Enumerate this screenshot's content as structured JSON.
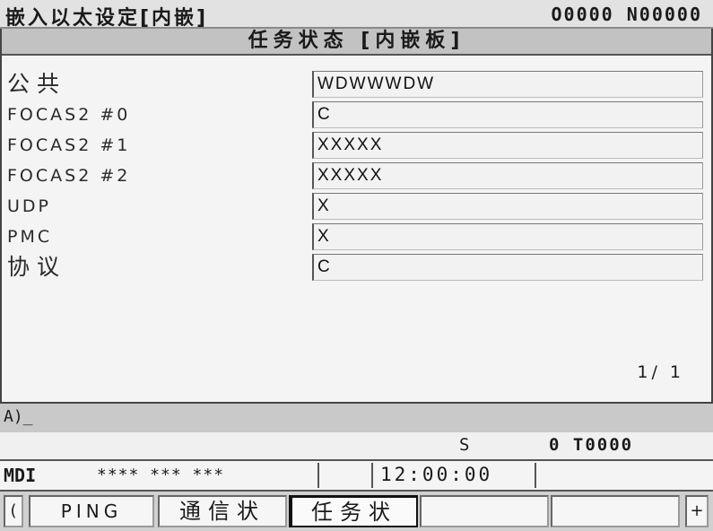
{
  "header": {
    "title": "嵌入以太设定[内嵌]",
    "program": "O0000 N00000"
  },
  "panel": {
    "title": "任务状态 [内嵌板]",
    "rows": [
      {
        "label": "公共",
        "value": "WDWWWDW"
      },
      {
        "label": "FOCAS2 #0",
        "value": "C"
      },
      {
        "label": "FOCAS2 #1",
        "value": "XXXXX"
      },
      {
        "label": "FOCAS2 #2",
        "value": "XXXXX"
      },
      {
        "label": "UDP",
        "value": "X"
      },
      {
        "label": "PMC",
        "value": "X"
      },
      {
        "label": "协议",
        "value": "C"
      }
    ],
    "page": "1/ 1"
  },
  "input": {
    "prompt": "A)_"
  },
  "info": {
    "spindle": "S",
    "tool": "0 T0000"
  },
  "status": {
    "mode": "MDI",
    "stars": "**** *** ***",
    "clock": "12:00:00"
  },
  "softkeys": {
    "prev": "(",
    "ping": "PING",
    "comm_status": "通信状",
    "task_status": "任务状",
    "blank1": "",
    "blank2": "",
    "next": "+"
  }
}
